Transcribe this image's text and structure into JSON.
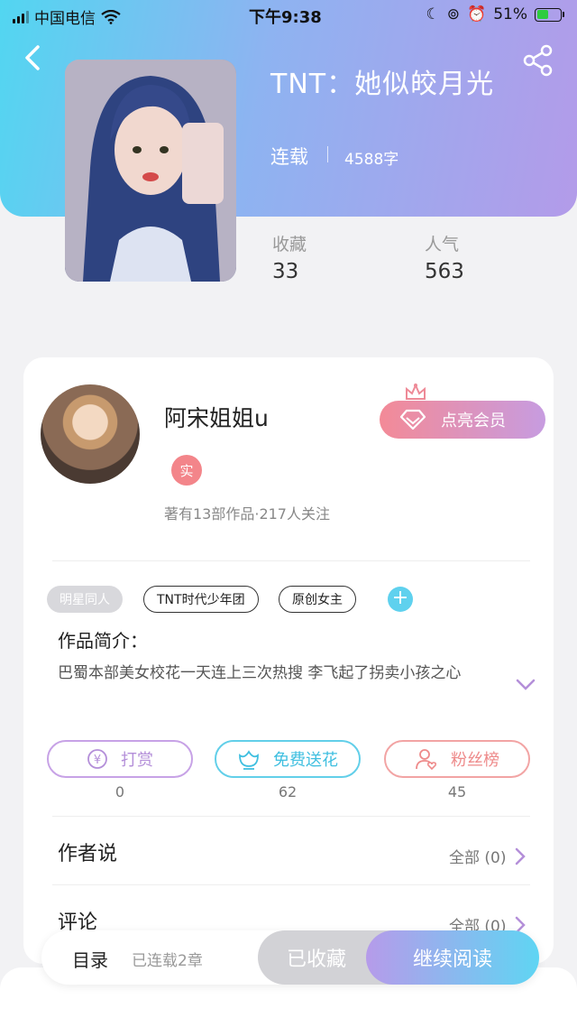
{
  "statusbar": {
    "carrier": "中国电信",
    "time": "下午9:38",
    "battery": "51%"
  },
  "book": {
    "title": "TNT：她似皎月光",
    "status": "连载",
    "word_count": "4588字",
    "stats": [
      {
        "label": "收藏",
        "value": "33"
      },
      {
        "label": "人气",
        "value": "563"
      }
    ]
  },
  "author": {
    "name": "阿宋姐姐u",
    "badge": "实",
    "summary": "著有13部作品·217人关注",
    "vip_button": "点亮会员"
  },
  "tags": [
    "明星同人",
    "TNT时代少年团",
    "原创女主"
  ],
  "intro": {
    "title": "作品简介：",
    "text": "巴蜀本部美女校花一天连上三次热搜 李飞起了拐卖小孩之心"
  },
  "actions": [
    {
      "label": "打赏",
      "count": "0"
    },
    {
      "label": "免费送花",
      "count": "62"
    },
    {
      "label": "粉丝榜",
      "count": "45"
    }
  ],
  "sections": [
    {
      "title": "作者说",
      "all": "全部 (0)"
    },
    {
      "title": "评论",
      "all": "全部 (0)"
    }
  ],
  "bottom": {
    "toc": "目录",
    "chapters": "已连载2章",
    "saved": "已收藏",
    "read": "继续阅读"
  },
  "colors": {
    "header_start": "#52d6f1",
    "header_end": "#b39be9",
    "accent_purple": "#b48fd9",
    "accent_blue": "#3fbfe0",
    "accent_pink": "#ee8a8a"
  }
}
